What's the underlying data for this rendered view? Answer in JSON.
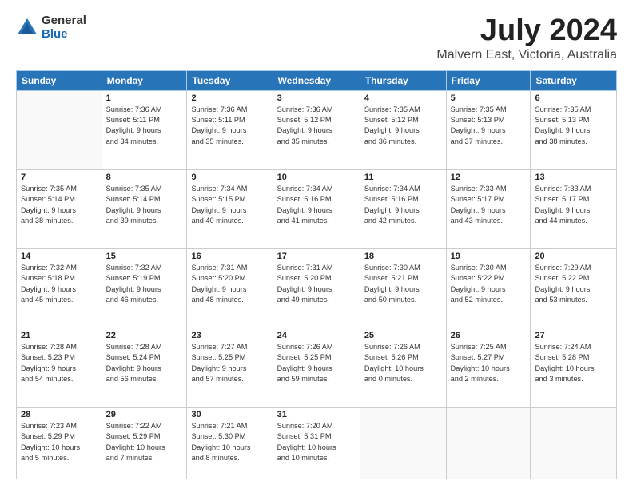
{
  "logo": {
    "general": "General",
    "blue": "Blue"
  },
  "header": {
    "month": "July 2024",
    "location": "Malvern East, Victoria, Australia"
  },
  "days": [
    "Sunday",
    "Monday",
    "Tuesday",
    "Wednesday",
    "Thursday",
    "Friday",
    "Saturday"
  ],
  "weeks": [
    [
      {
        "day": "",
        "content": ""
      },
      {
        "day": "1",
        "content": "Sunrise: 7:36 AM\nSunset: 5:11 PM\nDaylight: 9 hours\nand 34 minutes."
      },
      {
        "day": "2",
        "content": "Sunrise: 7:36 AM\nSunset: 5:11 PM\nDaylight: 9 hours\nand 35 minutes."
      },
      {
        "day": "3",
        "content": "Sunrise: 7:36 AM\nSunset: 5:12 PM\nDaylight: 9 hours\nand 35 minutes."
      },
      {
        "day": "4",
        "content": "Sunrise: 7:35 AM\nSunset: 5:12 PM\nDaylight: 9 hours\nand 36 minutes."
      },
      {
        "day": "5",
        "content": "Sunrise: 7:35 AM\nSunset: 5:13 PM\nDaylight: 9 hours\nand 37 minutes."
      },
      {
        "day": "6",
        "content": "Sunrise: 7:35 AM\nSunset: 5:13 PM\nDaylight: 9 hours\nand 38 minutes."
      }
    ],
    [
      {
        "day": "7",
        "content": "Sunrise: 7:35 AM\nSunset: 5:14 PM\nDaylight: 9 hours\nand 38 minutes."
      },
      {
        "day": "8",
        "content": "Sunrise: 7:35 AM\nSunset: 5:14 PM\nDaylight: 9 hours\nand 39 minutes."
      },
      {
        "day": "9",
        "content": "Sunrise: 7:34 AM\nSunset: 5:15 PM\nDaylight: 9 hours\nand 40 minutes."
      },
      {
        "day": "10",
        "content": "Sunrise: 7:34 AM\nSunset: 5:16 PM\nDaylight: 9 hours\nand 41 minutes."
      },
      {
        "day": "11",
        "content": "Sunrise: 7:34 AM\nSunset: 5:16 PM\nDaylight: 9 hours\nand 42 minutes."
      },
      {
        "day": "12",
        "content": "Sunrise: 7:33 AM\nSunset: 5:17 PM\nDaylight: 9 hours\nand 43 minutes."
      },
      {
        "day": "13",
        "content": "Sunrise: 7:33 AM\nSunset: 5:17 PM\nDaylight: 9 hours\nand 44 minutes."
      }
    ],
    [
      {
        "day": "14",
        "content": "Sunrise: 7:32 AM\nSunset: 5:18 PM\nDaylight: 9 hours\nand 45 minutes."
      },
      {
        "day": "15",
        "content": "Sunrise: 7:32 AM\nSunset: 5:19 PM\nDaylight: 9 hours\nand 46 minutes."
      },
      {
        "day": "16",
        "content": "Sunrise: 7:31 AM\nSunset: 5:20 PM\nDaylight: 9 hours\nand 48 minutes."
      },
      {
        "day": "17",
        "content": "Sunrise: 7:31 AM\nSunset: 5:20 PM\nDaylight: 9 hours\nand 49 minutes."
      },
      {
        "day": "18",
        "content": "Sunrise: 7:30 AM\nSunset: 5:21 PM\nDaylight: 9 hours\nand 50 minutes."
      },
      {
        "day": "19",
        "content": "Sunrise: 7:30 AM\nSunset: 5:22 PM\nDaylight: 9 hours\nand 52 minutes."
      },
      {
        "day": "20",
        "content": "Sunrise: 7:29 AM\nSunset: 5:22 PM\nDaylight: 9 hours\nand 53 minutes."
      }
    ],
    [
      {
        "day": "21",
        "content": "Sunrise: 7:28 AM\nSunset: 5:23 PM\nDaylight: 9 hours\nand 54 minutes."
      },
      {
        "day": "22",
        "content": "Sunrise: 7:28 AM\nSunset: 5:24 PM\nDaylight: 9 hours\nand 56 minutes."
      },
      {
        "day": "23",
        "content": "Sunrise: 7:27 AM\nSunset: 5:25 PM\nDaylight: 9 hours\nand 57 minutes."
      },
      {
        "day": "24",
        "content": "Sunrise: 7:26 AM\nSunset: 5:25 PM\nDaylight: 9 hours\nand 59 minutes."
      },
      {
        "day": "25",
        "content": "Sunrise: 7:26 AM\nSunset: 5:26 PM\nDaylight: 10 hours\nand 0 minutes."
      },
      {
        "day": "26",
        "content": "Sunrise: 7:25 AM\nSunset: 5:27 PM\nDaylight: 10 hours\nand 2 minutes."
      },
      {
        "day": "27",
        "content": "Sunrise: 7:24 AM\nSunset: 5:28 PM\nDaylight: 10 hours\nand 3 minutes."
      }
    ],
    [
      {
        "day": "28",
        "content": "Sunrise: 7:23 AM\nSunset: 5:29 PM\nDaylight: 10 hours\nand 5 minutes."
      },
      {
        "day": "29",
        "content": "Sunrise: 7:22 AM\nSunset: 5:29 PM\nDaylight: 10 hours\nand 7 minutes."
      },
      {
        "day": "30",
        "content": "Sunrise: 7:21 AM\nSunset: 5:30 PM\nDaylight: 10 hours\nand 8 minutes."
      },
      {
        "day": "31",
        "content": "Sunrise: 7:20 AM\nSunset: 5:31 PM\nDaylight: 10 hours\nand 10 minutes."
      },
      {
        "day": "",
        "content": ""
      },
      {
        "day": "",
        "content": ""
      },
      {
        "day": "",
        "content": ""
      }
    ]
  ]
}
